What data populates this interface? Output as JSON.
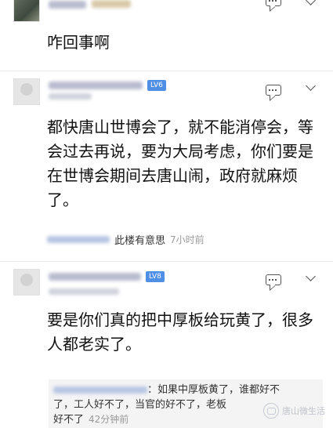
{
  "comments": [
    {
      "text": "咋回事啊"
    },
    {
      "badge": "LV6",
      "text_lines": [
        "都快唐山世博会了，就不能消停会，等",
        "会过去再说，要为大局考虑，你们要是",
        "在世博会期间去唐山闹，政府就麻烦",
        "了。"
      ],
      "reply": {
        "text": "此楼有意思",
        "time": "7小时前"
      }
    },
    {
      "badge": "LV8",
      "text_lines": [
        "要是你们真的把中厚板给玩黄了，很多",
        "人都老实了。"
      ],
      "quote": {
        "line1": "如果中厚板黄了，谁都好不",
        "line2": "了，工人好不了，当官的好不了，老板",
        "line3": "好不了",
        "time": "42分钟前"
      }
    }
  ],
  "watermark": "唐山微生活"
}
